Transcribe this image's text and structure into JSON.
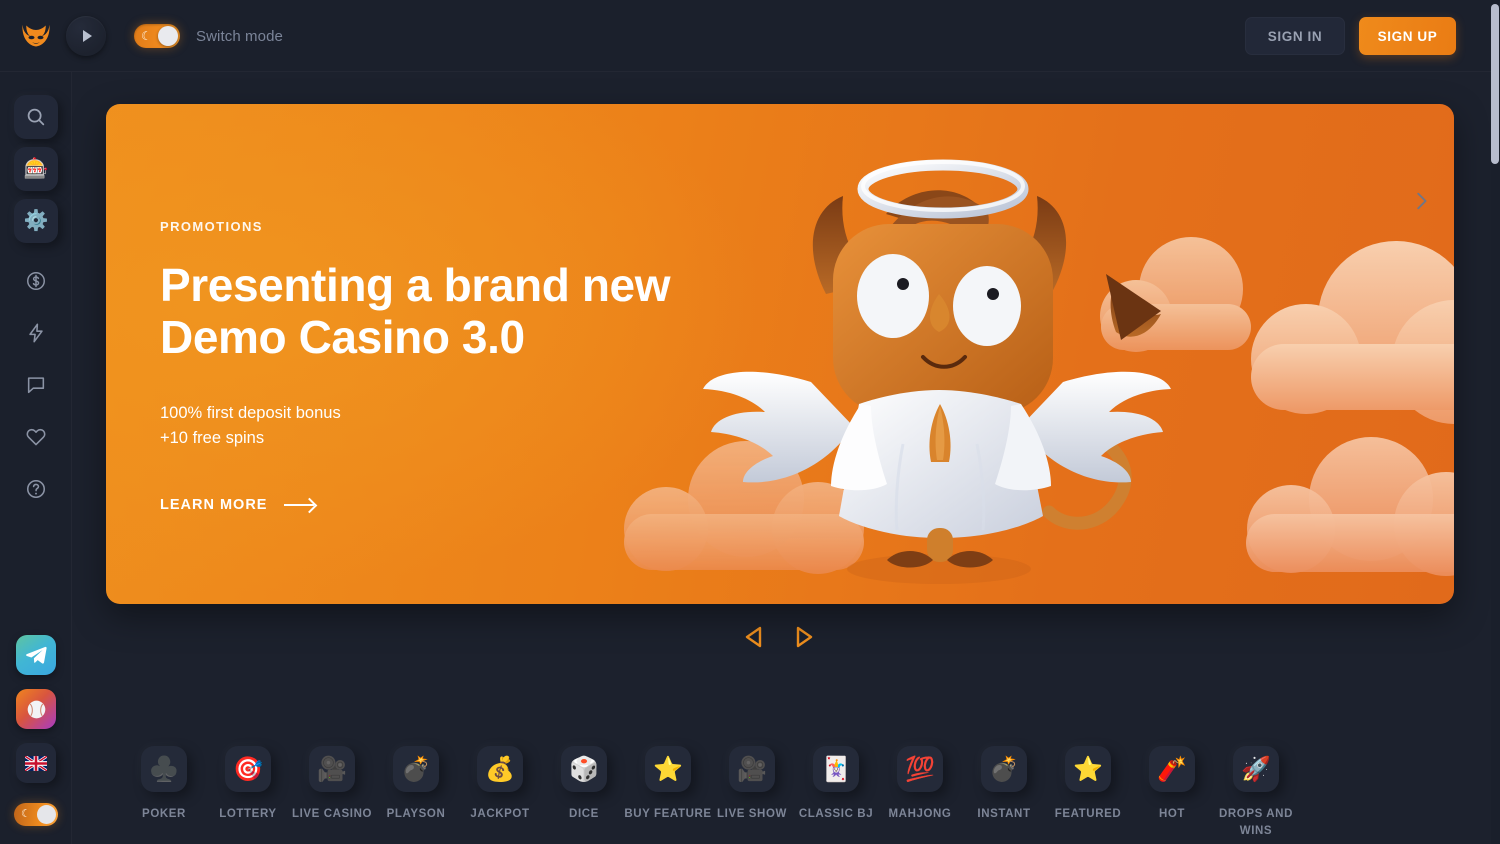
{
  "header": {
    "logo_icon": "devil-mask-logo",
    "play_icon": "play-icon",
    "switch_mode_label": "Switch mode",
    "switch_mode_state": "on",
    "sign_in_label": "SIGN IN",
    "sign_up_label": "SIGN UP",
    "accent_color": "#ef8a1b"
  },
  "sidebar": {
    "top_items": [
      {
        "name": "search",
        "icon": "search-icon",
        "raised": true
      },
      {
        "name": "slots",
        "icon": "slot-machine-icon",
        "glyph": "🎰",
        "raised": true
      },
      {
        "name": "settings",
        "icon": "gear-icon",
        "glyph": "⚙️",
        "raised": true
      },
      {
        "name": "payments",
        "icon": "dollar-circle-icon",
        "raised": false
      },
      {
        "name": "fast-games",
        "icon": "lightning-icon",
        "raised": false
      },
      {
        "name": "chat",
        "icon": "chat-bubble-icon",
        "raised": false
      },
      {
        "name": "favorites",
        "icon": "heart-icon",
        "raised": false
      },
      {
        "name": "help",
        "icon": "question-circle-icon",
        "raised": false
      }
    ],
    "bottom_items": [
      {
        "name": "telegram",
        "icon": "telegram-icon",
        "glyph": "✈"
      },
      {
        "name": "sports",
        "icon": "baseball-icon",
        "glyph": "⚾"
      },
      {
        "name": "language",
        "icon": "uk-flag-icon",
        "glyph": "🇬🇧"
      }
    ],
    "theme_toggle": {
      "name": "theme-toggle",
      "state": "on",
      "icon": "moon-icon"
    }
  },
  "banner": {
    "kicker": "PROMOTIONS",
    "headline_line1": "Presenting a brand new",
    "headline_line2": "Demo Casino 3.0",
    "sub_line1": "100% first deposit bonus",
    "sub_line2": "+10 free spins",
    "cta_label": "LEARN MORE",
    "mascot_alt": "angel-demon-mascot",
    "bg_color_left": "#f0941f",
    "bg_color_right": "#e16a1b"
  },
  "carousel": {
    "prev_label": "previous-slide",
    "next_label": "next-slide",
    "arrow_color": "#ef8f1e"
  },
  "categories": {
    "next_arrow_label": "scroll-categories-right",
    "items": [
      {
        "label": "POKER",
        "icon": "club-suit-icon",
        "glyph": "♣️"
      },
      {
        "label": "LOTTERY",
        "icon": "dart-board-icon",
        "glyph": "🎯"
      },
      {
        "label": "LIVE CASINO",
        "icon": "movie-camera-icon",
        "glyph": "🎥"
      },
      {
        "label": "PLAYSON",
        "icon": "bomb-icon",
        "glyph": "💣"
      },
      {
        "label": "JACKPOT",
        "icon": "money-bag-icon",
        "glyph": "💰"
      },
      {
        "label": "DICE",
        "icon": "dice-icon",
        "glyph": "🎲"
      },
      {
        "label": "BUY FEATURE",
        "icon": "star-icon",
        "glyph": "⭐"
      },
      {
        "label": "LIVE SHOW",
        "icon": "movie-camera-icon",
        "glyph": "🎥"
      },
      {
        "label": "CLASSIC BJ",
        "icon": "playing-card-icon",
        "glyph": "🃏"
      },
      {
        "label": "MAHJONG",
        "icon": "hundred-points-icon",
        "glyph": "💯"
      },
      {
        "label": "INSTANT",
        "icon": "bomb-icon",
        "glyph": "💣"
      },
      {
        "label": "FEATURED",
        "icon": "star-icon",
        "glyph": "⭐"
      },
      {
        "label": "HOT",
        "icon": "dynamite-icon",
        "glyph": "🧨"
      },
      {
        "label": "DROPS AND WINS",
        "icon": "rocket-icon",
        "glyph": "🚀"
      }
    ]
  },
  "scrollbar": {
    "name": "page-scrollbar",
    "thumb_color": "#b7bccd"
  }
}
